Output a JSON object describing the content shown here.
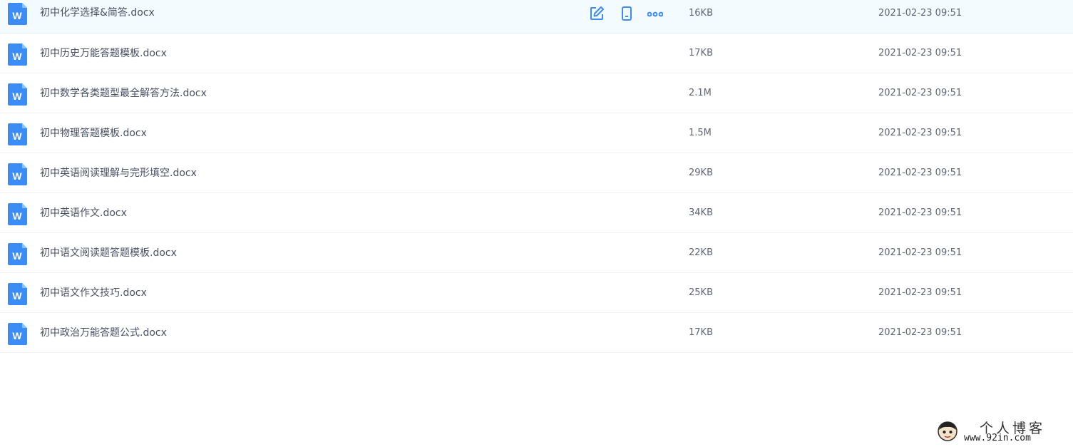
{
  "files": [
    {
      "name": "初中化学选择&简答.docx",
      "size": "16KB",
      "date": "2021-02-23 09:51",
      "hovered": true
    },
    {
      "name": "初中历史万能答题模板.docx",
      "size": "17KB",
      "date": "2021-02-23 09:51"
    },
    {
      "name": "初中数学各类题型最全解答方法.docx",
      "size": "2.1M",
      "date": "2021-02-23 09:51"
    },
    {
      "name": "初中物理答题模板.docx",
      "size": "1.5M",
      "date": "2021-02-23 09:51"
    },
    {
      "name": "初中英语阅读理解与完形填空.docx",
      "size": "29KB",
      "date": "2021-02-23 09:51"
    },
    {
      "name": "初中英语作文.docx",
      "size": "34KB",
      "date": "2021-02-23 09:51"
    },
    {
      "name": "初中语文阅读题答题模板.docx",
      "size": "22KB",
      "date": "2021-02-23 09:51"
    },
    {
      "name": "初中语文作文技巧.docx",
      "size": "25KB",
      "date": "2021-02-23 09:51"
    },
    {
      "name": "初中政治万能答题公式.docx",
      "size": "17KB",
      "date": "2021-02-23 09:51"
    }
  ],
  "file_icon": {
    "name": "word-doc-icon",
    "letter": "W",
    "color": "#3b8cf5"
  },
  "row_actions": [
    "edit-icon",
    "phone-icon",
    "more-icon"
  ],
  "colors": {
    "accent": "#3b8cf5",
    "hover_row_bg": "#f4fbff",
    "text": "#4a5064",
    "meta_text": "#5f6475"
  },
  "watermark": {
    "title": "个人博客",
    "url": "www.92in.com"
  }
}
